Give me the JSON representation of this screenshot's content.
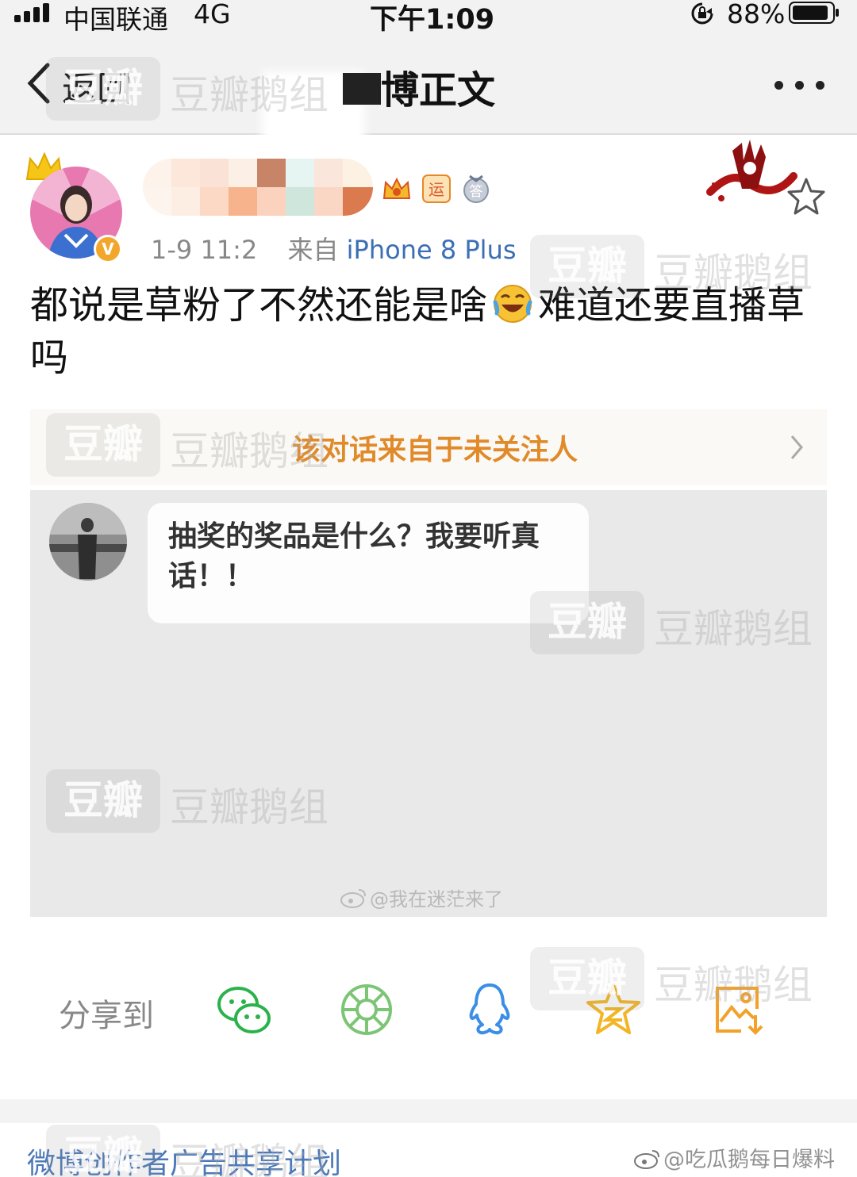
{
  "status_bar": {
    "carrier": "中国联通",
    "network": "4G",
    "time": "下午1:09",
    "battery": "88%"
  },
  "nav": {
    "back_label": "返回",
    "title": "博正文",
    "more_icon": "more-dots-icon"
  },
  "post": {
    "meta_time": "1-9 11:2",
    "meta_source_prefix": "来自",
    "meta_source": "iPhone 8 Plus",
    "text_part1": "都说是草粉了不然还能是啥",
    "emoji": "laugh-cry-emoji",
    "text_part2": "难道还要直播草吗",
    "verified_badge": "V",
    "badge_icons": [
      "crown-badge-icon",
      "yun-badge-icon",
      "answer-badge-icon"
    ]
  },
  "embedded_screenshot": {
    "notice": "该对话来自于未关注人",
    "message": "抽奖的奖品是什么？我要听真话！！",
    "image_watermark": "@我在迷茫来了"
  },
  "share": {
    "label": "分享到",
    "targets": [
      "wechat-icon",
      "moments-icon",
      "qq-icon",
      "qzone-icon",
      "save-image-icon"
    ]
  },
  "footer": {
    "ad_plan": "微博创作者广告共享计划",
    "source_watermark": "@吃瓜鹅每日爆料"
  },
  "watermark_text": {
    "box": "豆瓣",
    "text": "豆瓣鹅组"
  },
  "colors": {
    "link_blue": "#3b6fb6",
    "notice_orange": "#e08a2a",
    "wechat_green": "#2bb24c",
    "moments_green": "#7cc576",
    "qq_blue": "#3a8ee6",
    "qzone_gold": "#f3b523",
    "album_orange": "#f3a12a"
  }
}
